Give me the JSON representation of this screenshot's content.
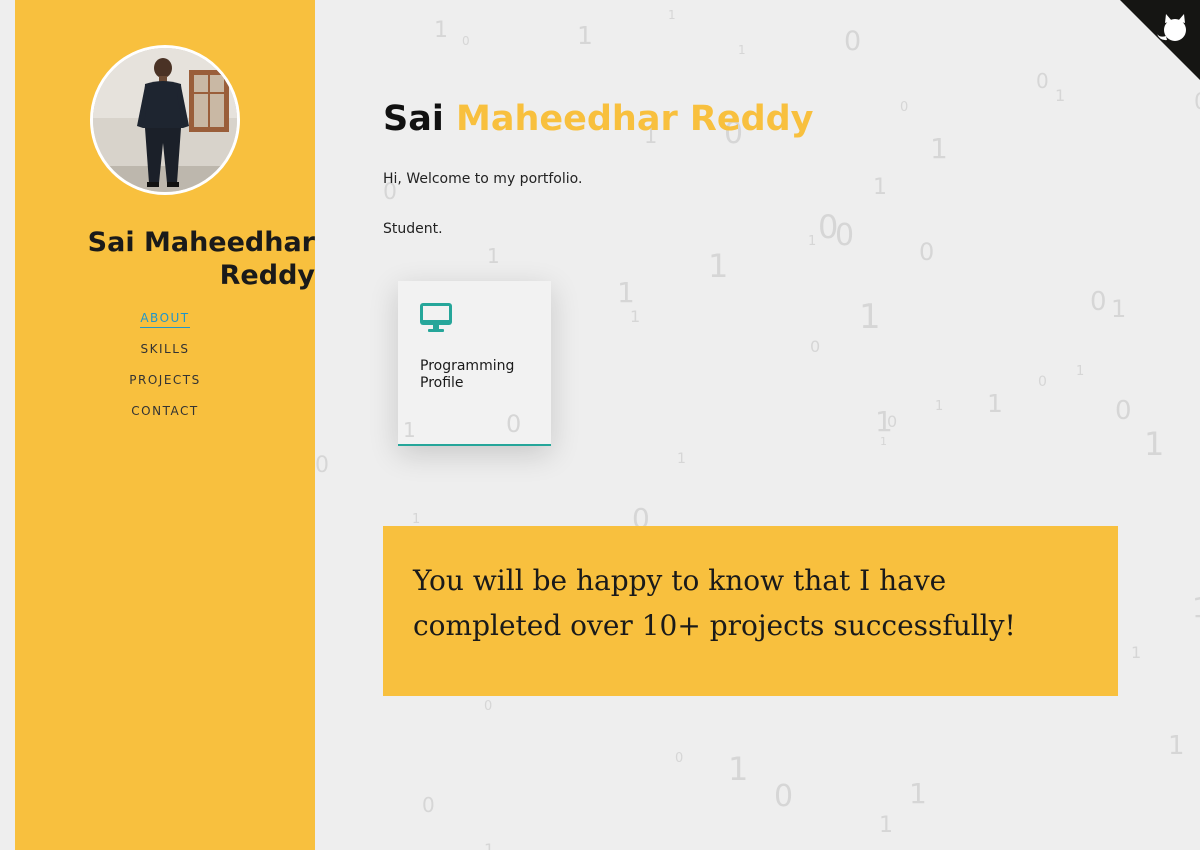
{
  "sidebar": {
    "name": "Sai Maheedhar Reddy",
    "nav": [
      {
        "label": "ABOUT",
        "active": true
      },
      {
        "label": "SKILLS",
        "active": false
      },
      {
        "label": "PROJECTS",
        "active": false
      },
      {
        "label": "CONTACT",
        "active": false
      }
    ]
  },
  "main": {
    "title_first": "Sai",
    "title_rest": "Maheedhar Reddy",
    "welcome": "Hi, Welcome to my portfolio.",
    "role": "Student.",
    "card": {
      "icon": "desktop-monitor-icon",
      "label": "Programming Profile"
    },
    "banner": "You will be happy to know that I have completed over 10+ projects successfully!"
  },
  "corner": {
    "icon": "github-octocat-icon"
  },
  "background": {
    "digit_pattern": "binary 0/1"
  },
  "colors": {
    "sidebar": "#f8c03e",
    "accent_text": "#f8c03e",
    "nav_active": "#2196c9",
    "card_icon": "#26a69a",
    "page_bg": "#eeeeee",
    "banner": "#f8c03e"
  }
}
